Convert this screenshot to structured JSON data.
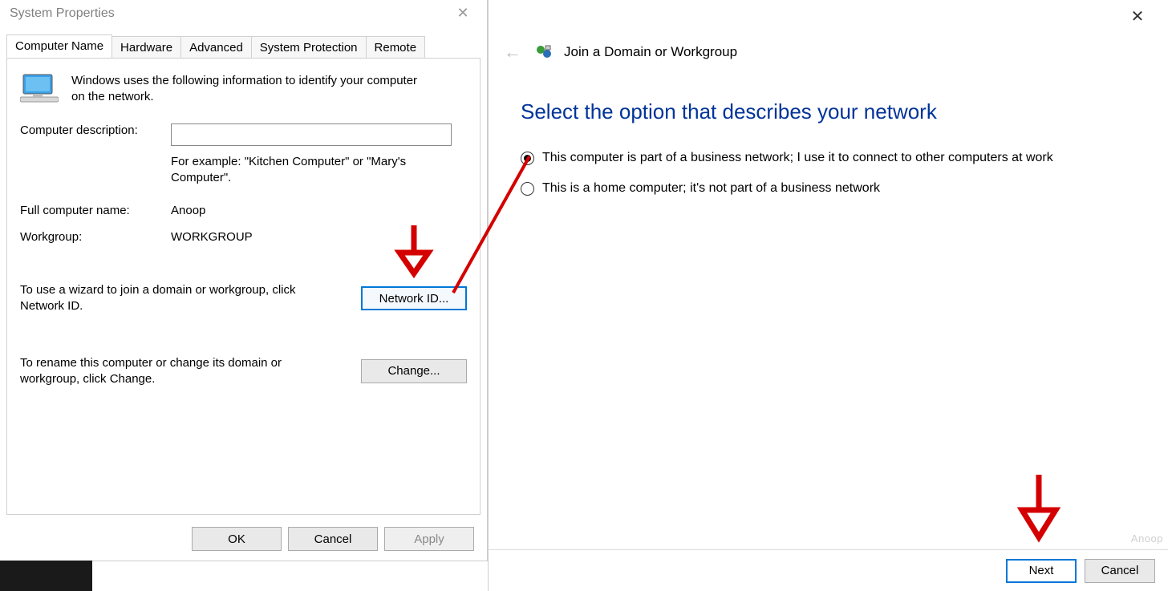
{
  "sysprops": {
    "title": "System Properties",
    "tabs": [
      "Computer Name",
      "Hardware",
      "Advanced",
      "System Protection",
      "Remote"
    ],
    "active_tab": 0,
    "intro": "Windows uses the following information to identify your computer on the network.",
    "desc_label": "Computer description:",
    "desc_value": "",
    "desc_hint": "For example: \"Kitchen Computer\" or \"Mary's Computer\".",
    "fullname_label": "Full computer name:",
    "fullname_value": "Anoop",
    "workgroup_label": "Workgroup:",
    "workgroup_value": "WORKGROUP",
    "netid_desc": "To use a wizard to join a domain or workgroup, click Network ID.",
    "netid_btn": "Network ID...",
    "change_desc": "To rename this computer or change its domain or workgroup, click Change.",
    "change_btn": "Change...",
    "ok": "OK",
    "cancel": "Cancel",
    "apply": "Apply"
  },
  "wizard": {
    "title": "Join a Domain or Workgroup",
    "heading": "Select the option that describes your network",
    "options": [
      "This computer is part of a business network; I use it to connect to other computers at work",
      "This is a home computer; it's not part of a business network"
    ],
    "selected": 0,
    "next": "Next",
    "cancel": "Cancel"
  },
  "watermark": "Anoop"
}
